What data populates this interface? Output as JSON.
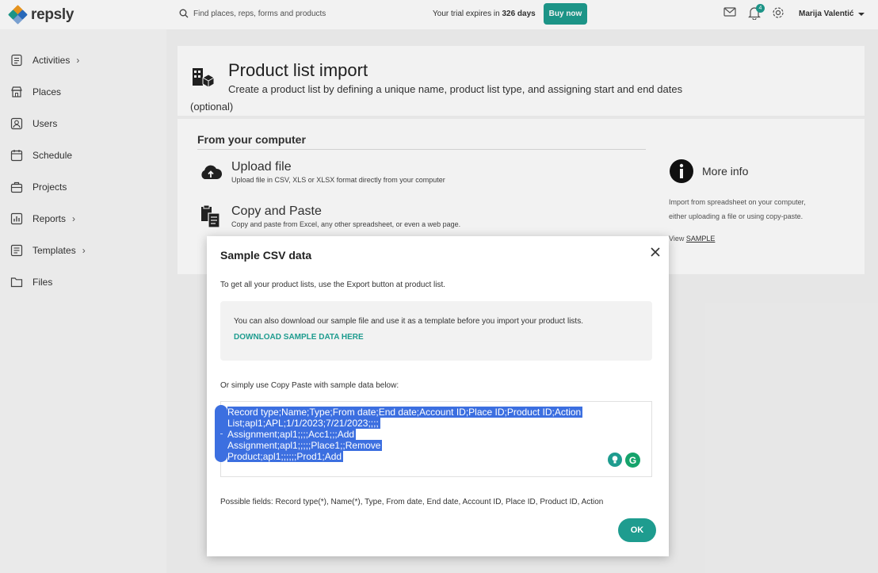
{
  "brand": {
    "name": "repsly",
    "accent": "#1e9c8f"
  },
  "topbar": {
    "search_placeholder": "Find places, reps, forms and products",
    "trial_prefix": "Your trial expires in",
    "trial_days": "326 days",
    "buy_label": "Buy now",
    "notifications_count": "4",
    "user_name": "Marija Valentić"
  },
  "sidebar": {
    "items": [
      {
        "label": "Activities",
        "icon": "activities-icon",
        "has_chevron": true
      },
      {
        "label": "Places",
        "icon": "places-icon",
        "has_chevron": false
      },
      {
        "label": "Users",
        "icon": "users-icon",
        "has_chevron": false
      },
      {
        "label": "Schedule",
        "icon": "calendar-icon",
        "has_chevron": false
      },
      {
        "label": "Projects",
        "icon": "briefcase-icon",
        "has_chevron": false
      },
      {
        "label": "Reports",
        "icon": "chart-icon",
        "has_chevron": true
      },
      {
        "label": "Templates",
        "icon": "templates-icon",
        "has_chevron": true
      },
      {
        "label": "Files",
        "icon": "folder-icon",
        "has_chevron": false
      }
    ]
  },
  "page": {
    "title": "Product list import",
    "description_line1": "Create a product list by defining a unique name, product list type, and assigning start and end dates",
    "description_line2": "(optional)",
    "section_title": "From your computer",
    "upload": {
      "title": "Upload file",
      "subtitle": "Upload file in CSV, XLS or XLSX format directly from your computer"
    },
    "copy_paste": {
      "title": "Copy and Paste",
      "subtitle": "Copy and paste from Excel, any other spreadsheet, or even a web page."
    },
    "more_info": {
      "title": "More info",
      "text_line1": "Import from spreadsheet on your computer,",
      "text_line2": "either uploading a file or using copy-paste.",
      "view_prefix": "View",
      "view_link": "SAMPLE"
    }
  },
  "modal": {
    "title": "Sample CSV data",
    "intro": "To get all your product lists, use the Export button at product list.",
    "info_text": "You can also download our sample file and use it as a template before you import your product lists.",
    "download_link": "DOWNLOAD SAMPLE DATA HERE",
    "copy_intro": "Or simply use Copy Paste with sample data below:",
    "sample_lines": [
      "Record type;Name;Type;From date;End date;Account ID;Place ID;Product ID;Action",
      "List;apl1;APL;1/1/2023;7/21/2023;;;;",
      "Assignment;apl1;;;;Acc1;;;Add",
      "Assignment;apl1;;;;;Place1;;Remove",
      "Product;apl1;;;;;;Prod1;Add"
    ],
    "possible_fields": "Possible fields: Record type(*), Name(*), Type, From date, End date, Account ID, Place ID, Product ID, Action",
    "ok_label": "OK"
  }
}
